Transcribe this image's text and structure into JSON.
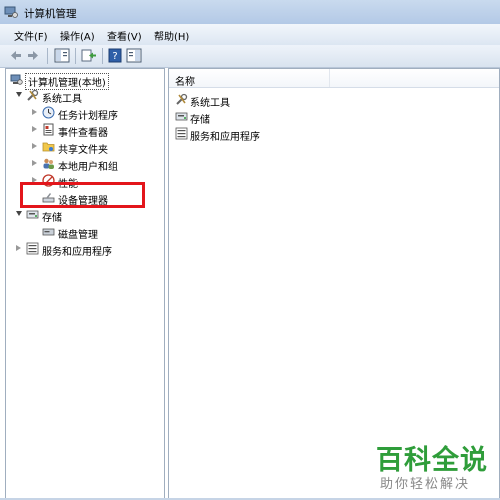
{
  "window": {
    "title": "计算机管理"
  },
  "menu": [
    "文件(F)",
    "操作(A)",
    "查看(V)",
    "帮助(H)"
  ],
  "tree": {
    "root": "计算机管理(本地)",
    "system_tools": "系统工具",
    "task_scheduler": "任务计划程序",
    "event_viewer": "事件查看器",
    "shared_folders": "共享文件夹",
    "local_users": "本地用户和组",
    "performance": "性能",
    "device_manager": "设备管理器",
    "storage": "存储",
    "disk_management": "磁盘管理",
    "services_apps": "服务和应用程序"
  },
  "list": {
    "column_name": "名称",
    "items": [
      "系统工具",
      "存储",
      "服务和应用程序"
    ]
  },
  "watermark": {
    "title": "百科全说",
    "subtitle": "助你轻松解决"
  },
  "colors": {
    "highlight": "#e3151b",
    "watermark": "#2f9d3a"
  }
}
